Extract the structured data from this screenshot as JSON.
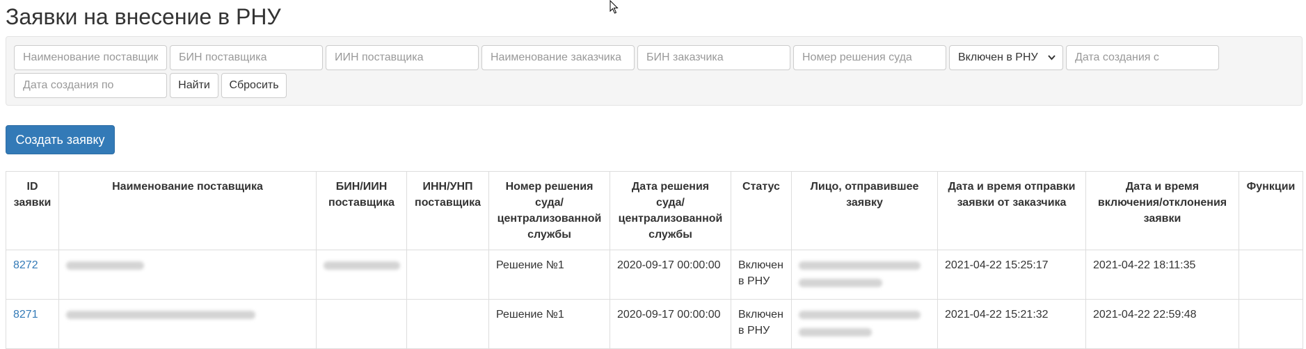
{
  "page_title": "Заявки на внесение в РНУ",
  "filters": {
    "supplier_name_placeholder": "Наименование поставщика",
    "supplier_bin_placeholder": "БИН поставщика",
    "supplier_iin_placeholder": "ИИН поставщика",
    "customer_name_placeholder": "Наименование заказчика",
    "customer_bin_placeholder": "БИН заказчика",
    "court_decision_placeholder": "Номер решения суда",
    "status_selected": "Включен в РНУ",
    "created_from_placeholder": "Дата создания с",
    "created_to_placeholder": "Дата создания по",
    "find_label": "Найти",
    "reset_label": "Сбросить"
  },
  "create_button_label": "Создать заявку",
  "table": {
    "headers": [
      "ID заявки",
      "Наименование поставщика",
      "БИН/ИИН поставщика",
      "ИНН/УНП поставщика",
      "Номер решения суда/ централизованной службы",
      "Дата решения суда/ централизованной службы",
      "Статус",
      "Лицо, отправившее заявку",
      "Дата и время отправки заявки от заказчика",
      "Дата и время включения/отклонения заявки",
      "Функции"
    ],
    "rows": [
      {
        "id": "8272",
        "supplier_name": "",
        "bin_iin": "",
        "inn_unp": "",
        "decision_number": "Решение №1",
        "decision_date": "2020-09-17 00:00:00",
        "status": "Включен в РНУ",
        "sender": "",
        "sent_at": "2021-04-22 15:25:17",
        "decided_at": "2021-04-22 18:11:35",
        "functions": ""
      },
      {
        "id": "8271",
        "supplier_name": "",
        "bin_iin": "",
        "inn_unp": "",
        "decision_number": "Решение №1",
        "decision_date": "2020-09-17 00:00:00",
        "status": "Включен в РНУ",
        "sender": "",
        "sent_at": "2021-04-22 15:21:32",
        "decided_at": "2021-04-22 22:59:48",
        "functions": ""
      }
    ]
  },
  "colors": {
    "primary": "#337ab7",
    "link": "#337ab7",
    "well_bg": "#f5f5f5",
    "border": "#dddddd"
  },
  "icons": {
    "cursor": "mouse-pointer-icon",
    "select_arrow": "chevron-down-icon"
  }
}
